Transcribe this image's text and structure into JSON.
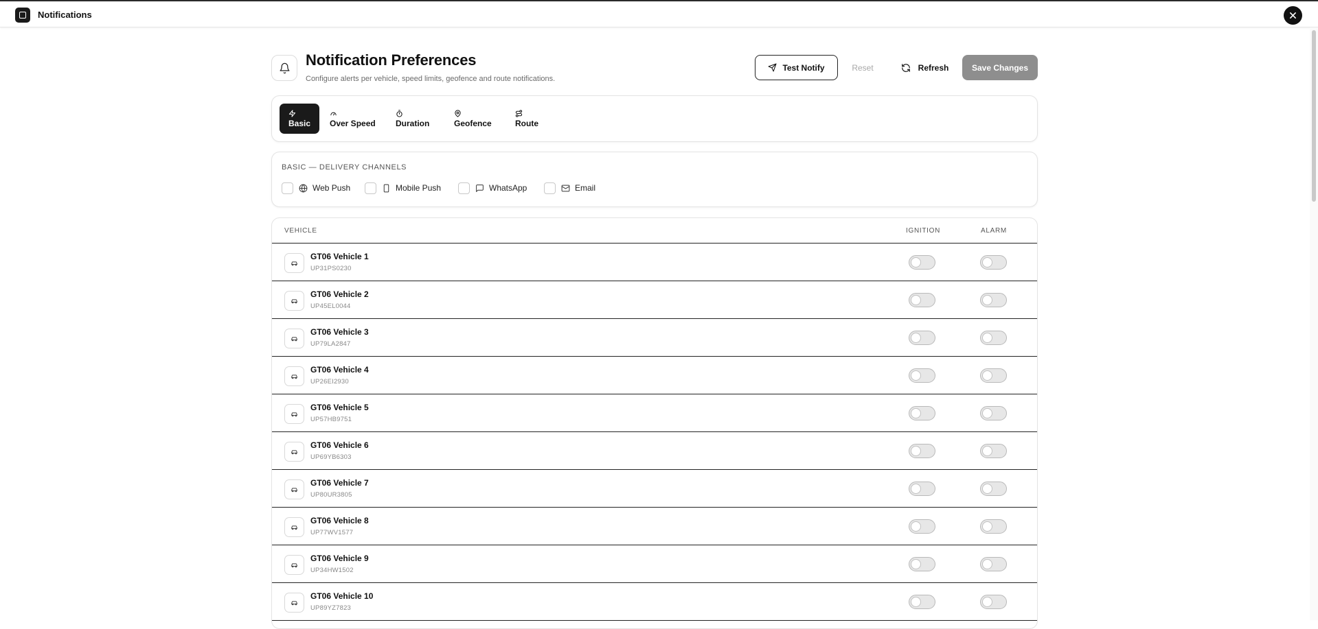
{
  "window": {
    "title": "Notifications"
  },
  "header": {
    "title": "Notification Preferences",
    "subtitle": "Configure alerts per vehicle, speed limits, geofence and route notifications."
  },
  "actions": {
    "test_label": "Test Notify",
    "reset_label": "Reset",
    "refresh_label": "Refresh",
    "save_label": "Save Changes"
  },
  "tabs": [
    {
      "label": "Basic",
      "icon": "lightning-icon",
      "active": true
    },
    {
      "label": "Over Speed",
      "icon": "speedometer-icon",
      "active": false
    },
    {
      "label": "Duration",
      "icon": "timer-icon",
      "active": false
    },
    {
      "label": "Geofence",
      "icon": "map-pin-icon",
      "active": false
    },
    {
      "label": "Route",
      "icon": "route-icon",
      "active": false
    }
  ],
  "channels": {
    "heading": "BASIC — DELIVERY CHANNELS",
    "items": [
      {
        "label": "Web Push",
        "icon": "globe-icon",
        "checked": false
      },
      {
        "label": "Mobile Push",
        "icon": "smartphone-icon",
        "checked": false
      },
      {
        "label": "WhatsApp",
        "icon": "message-icon",
        "checked": false
      },
      {
        "label": "Email",
        "icon": "mail-icon",
        "checked": false
      }
    ]
  },
  "table": {
    "columns": {
      "vehicle": "VEHICLE",
      "ignition": "IGNITION",
      "alarm": "ALARM"
    },
    "rows": [
      {
        "name": "GT06 Vehicle 1",
        "plate": "UP31PS0230",
        "ignition": false,
        "alarm": false
      },
      {
        "name": "GT06 Vehicle 2",
        "plate": "UP45EL0044",
        "ignition": false,
        "alarm": false
      },
      {
        "name": "GT06 Vehicle 3",
        "plate": "UP79LA2847",
        "ignition": false,
        "alarm": false
      },
      {
        "name": "GT06 Vehicle 4",
        "plate": "UP26EI2930",
        "ignition": false,
        "alarm": false
      },
      {
        "name": "GT06 Vehicle 5",
        "plate": "UP57HB9751",
        "ignition": false,
        "alarm": false
      },
      {
        "name": "GT06 Vehicle 6",
        "plate": "UP69YB6303",
        "ignition": false,
        "alarm": false
      },
      {
        "name": "GT06 Vehicle 7",
        "plate": "UP80UR3805",
        "ignition": false,
        "alarm": false
      },
      {
        "name": "GT06 Vehicle 8",
        "plate": "UP77WV1577",
        "ignition": false,
        "alarm": false
      },
      {
        "name": "GT06 Vehicle 9",
        "plate": "UP34HW1502",
        "ignition": false,
        "alarm": false
      },
      {
        "name": "GT06 Vehicle 10",
        "plate": "UP89YZ7823",
        "ignition": false,
        "alarm": false
      }
    ]
  },
  "colors": {
    "accent": "#1a1a1a",
    "save_disabled": "#8e8e8e",
    "muted_text": "#6b6b6b"
  }
}
